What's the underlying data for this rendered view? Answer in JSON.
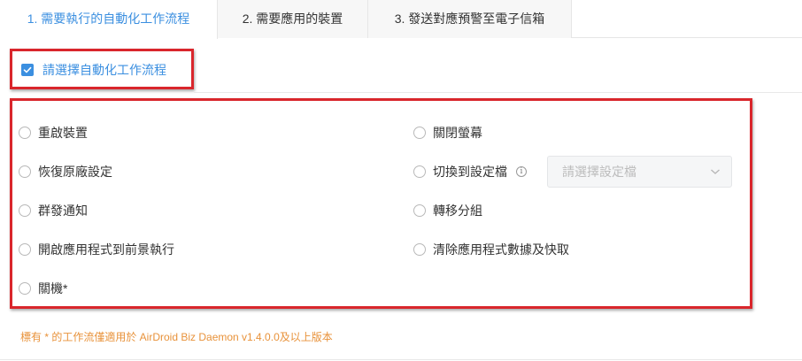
{
  "tabs": [
    {
      "label": "1. 需要執行的自動化工作流程",
      "active": true
    },
    {
      "label": "2. 需要應用的裝置",
      "active": false
    },
    {
      "label": "3. 發送對應預警至電子信箱",
      "active": false
    }
  ],
  "select_all": {
    "label": "請選擇自動化工作流程",
    "checked": true
  },
  "options": {
    "reboot": "重啟裝置",
    "factory_reset": "恢復原廠設定",
    "group_notify": "群發通知",
    "open_app_foreground": "開啟應用程式到前景執行",
    "shutdown": "關機*",
    "screen_off": "關閉螢幕",
    "switch_profile": "切換到設定檔",
    "transfer_group": "轉移分組",
    "clear_app_data": "清除應用程式數據及快取"
  },
  "profile_select": {
    "placeholder": "請選擇設定檔"
  },
  "footnote": "標有 * 的工作流僅適用於 AirDroid Biz Daemon v1.4.0.0及以上版本",
  "colors": {
    "accent": "#3b8fe0",
    "highlight_box": "#d9262c",
    "footnote": "#e8923a"
  }
}
